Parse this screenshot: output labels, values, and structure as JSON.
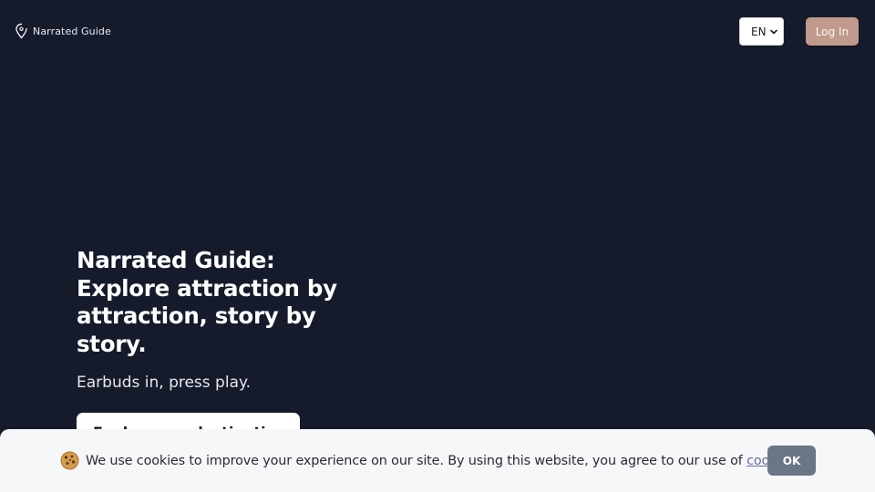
{
  "header": {
    "brand_name": "Narrated Guide",
    "brand_icon": "map-pin-outline-icon",
    "language": {
      "selected": "EN"
    },
    "login_label": "Log In"
  },
  "hero": {
    "title_lines": [
      "Narrated Guide:",
      "Explore attraction by",
      "attraction, story by",
      "story."
    ],
    "subtitle": "Earbuds in, press play.",
    "cta_label": "Explore our destinations"
  },
  "cookie_banner": {
    "icon": "cookie-emoji",
    "text_before_link": "We use cookies to improve your experience on our site. By using this website, you agree to our use of ",
    "link_text": "cookies",
    "text_after_link": ".",
    "ok_label": "OK"
  },
  "colors": {
    "background": "#161b2b",
    "login_button": "#c09a8c",
    "ok_button": "#6a7586",
    "link": "#6d6aa8"
  }
}
